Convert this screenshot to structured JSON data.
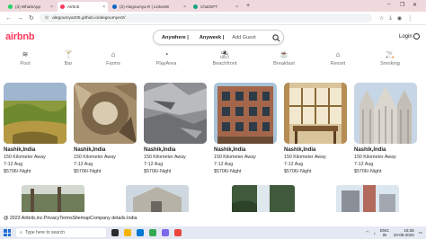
{
  "browser": {
    "tabs": [
      {
        "label": "(3) WhatsApp",
        "favicon_color": "#25d366",
        "active": false
      },
      {
        "label": "Airbnb",
        "favicon_color": "#ff385c",
        "active": true
      },
      {
        "label": "(2) Alegoumya R | LinkedIn",
        "favicon_color": "#0a66c2",
        "active": false
      },
      {
        "label": "ChatGPT",
        "favicon_color": "#10a37f",
        "active": false
      }
    ],
    "url": "alegoumya205.github.io/alegoumyer2/"
  },
  "header": {
    "logo": "airbnb",
    "search": {
      "anywhere": "Anywhere |",
      "anyweek": "Anyweek |",
      "add_guest": "Add Guest"
    },
    "login": "Login"
  },
  "categories": [
    {
      "label": "Pool",
      "icon": "pool-icon",
      "glyph": "≋"
    },
    {
      "label": "Bar",
      "icon": "bar-icon",
      "glyph": "🍸"
    },
    {
      "label": "Farms",
      "icon": "farm-icon",
      "glyph": "⌂"
    },
    {
      "label": "PlayArea",
      "icon": "play-area-icon",
      "glyph": "◔"
    },
    {
      "label": "Beachfront",
      "icon": "beach-icon",
      "glyph": "⛱"
    },
    {
      "label": "Breakfast",
      "icon": "breakfast-icon",
      "glyph": "☕"
    },
    {
      "label": "Resort",
      "icon": "resort-icon",
      "glyph": "⌂"
    },
    {
      "label": "Smoking",
      "icon": "smoking-icon",
      "glyph": "🚬"
    }
  ],
  "listings": [
    {
      "title": "Nashik,India",
      "distance": "150 Kilometer Away",
      "dates": "7-12 Aug",
      "price": "$5706/-Night",
      "image": "green-hillside"
    },
    {
      "title": "Nashik,India",
      "distance": "150 Kilometer Away",
      "dates": "7-12 Aug",
      "price": "$5706/-Night",
      "image": "rock-nest"
    },
    {
      "title": "Nashik,India",
      "distance": "150 Kilometer Away",
      "dates": "7-12 Aug",
      "price": "$5706/-Night",
      "image": "rocky-terrain"
    },
    {
      "title": "Nashik,India",
      "distance": "150 Kilometer Away",
      "dates": "7-12 Aug",
      "price": "$5706/-Night",
      "image": "brick-apartment"
    },
    {
      "title": "Nashik,India",
      "distance": "150 Kilometer Away",
      "dates": "7-12 Aug",
      "price": "$5706/-Night",
      "image": "dining-room"
    },
    {
      "title": "Nashik,India",
      "distance": "150 Kilometer Away",
      "dates": "7-12 Aug",
      "price": "$5706/-Night",
      "image": "gothic-cathedral"
    }
  ],
  "footer": "@ 2023 Airbnb,inc.PrivacyTermsSitemapCompany details.India",
  "taskbar": {
    "search_placeholder": "Type here to search",
    "lang": "ENG",
    "region": "IN",
    "time": "16:35",
    "date": "10-05-2024"
  },
  "colors": {
    "brand": "#ff385c",
    "taskbar": "#e4e9f3",
    "tabbar": "#f0d9dd"
  }
}
